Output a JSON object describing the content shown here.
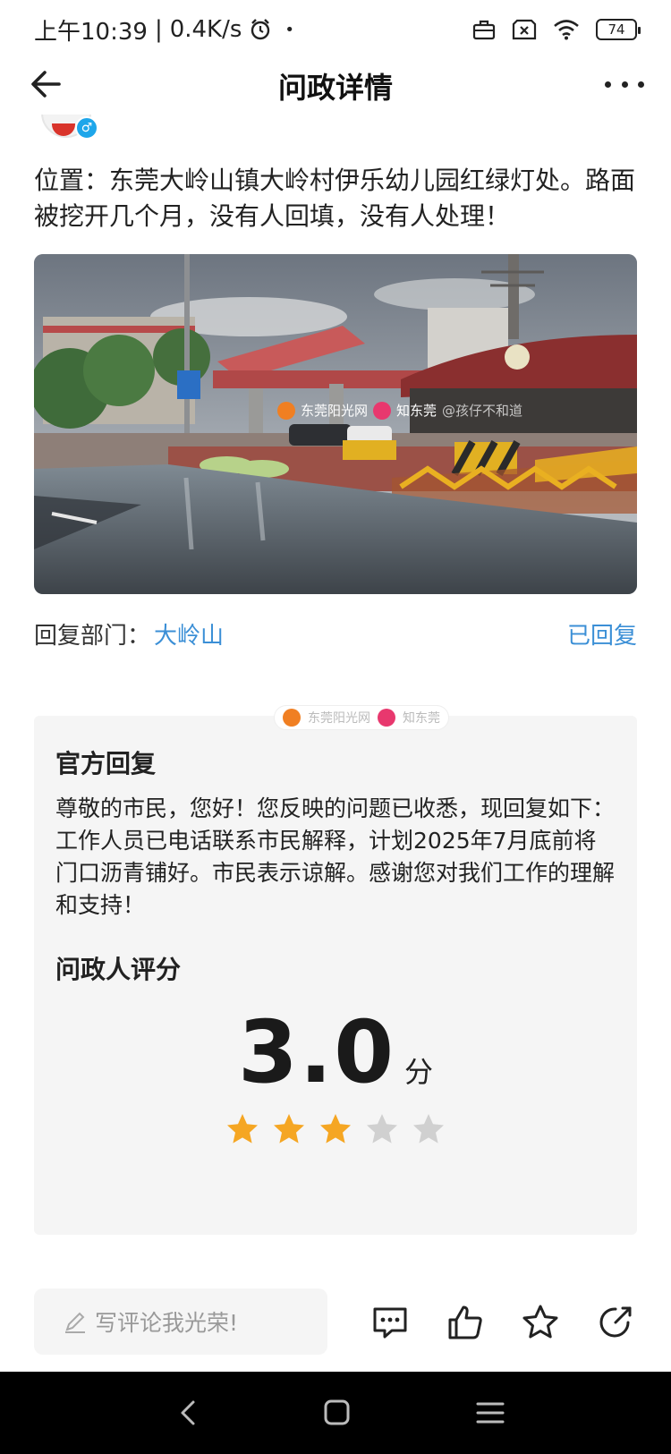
{
  "status_bar": {
    "time": "上午10:39",
    "speed": "0.4K/s",
    "battery": "74"
  },
  "header": {
    "title": "问政详情"
  },
  "post": {
    "text": "位置：东莞大岭山镇大岭村伊乐幼儿园红绿灯处。路面被挖开几个月，没有人回填，没有人处理！",
    "photo_watermark_1": "东莞阳光网",
    "photo_watermark_2": "知东莞",
    "photo_watermark_3": "@孩仔不和道"
  },
  "reply_department": {
    "label": "回复部门：",
    "name": "大岭山",
    "status": "已回复"
  },
  "official_reply": {
    "watermark_1": "东莞阳光网",
    "watermark_2": "知东莞",
    "title": "官方回复",
    "text": "尊敬的市民，您好！您反映的问题已收悉，现回复如下：工作人员已电话联系市民解释，计划2025年7月底前将门口沥青铺好。市民表示谅解。感谢您对我们工作的理解和支持！",
    "rating_title": "问政人评分",
    "score": "3.0",
    "score_unit": "分",
    "stars_filled": 3,
    "stars_total": 5,
    "star_color_filled": "#f5a623",
    "star_color_empty": "#d0d0d0"
  },
  "comment_bar": {
    "placeholder": "写评论我光荣!"
  },
  "colors": {
    "accent": "#3b8fd6"
  }
}
